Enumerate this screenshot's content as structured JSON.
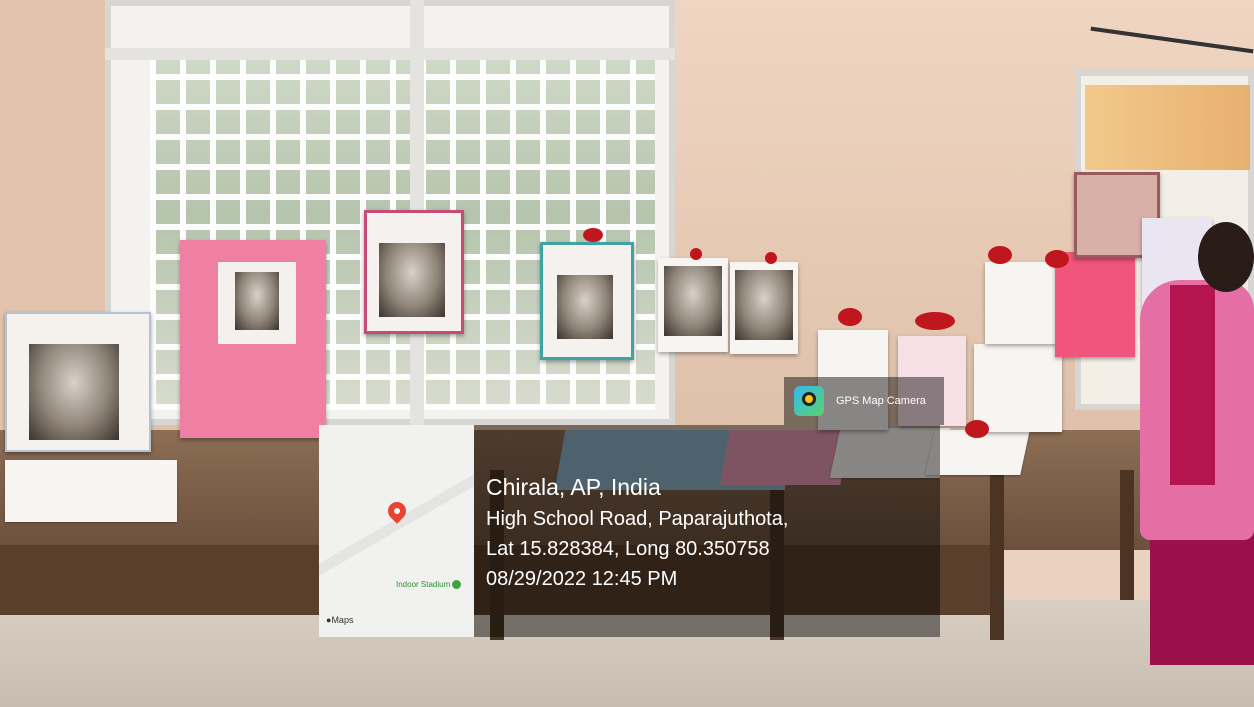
{
  "scene": {
    "description_labels": [
      "photo"
    ]
  },
  "gps_badge": {
    "app_name": "GPS Map Camera",
    "icon": "gps-map-camera-icon"
  },
  "location_info": {
    "place": "Chirala, AP, India",
    "address": "High School Road, Paparajuthota,",
    "coordinates": "Lat 15.828384, Long 80.350758",
    "datetime": "08/29/2022 12:45 PM"
  },
  "map_thumbnail": {
    "poi_label": "Indoor Stadium",
    "attribution": "Maps",
    "pin_icon": "map-pin-icon",
    "pin_color": "#e8442f"
  },
  "colors": {
    "pink_poster": "#f07fa4",
    "overlay": "rgba(0,0,0,0.45)"
  }
}
